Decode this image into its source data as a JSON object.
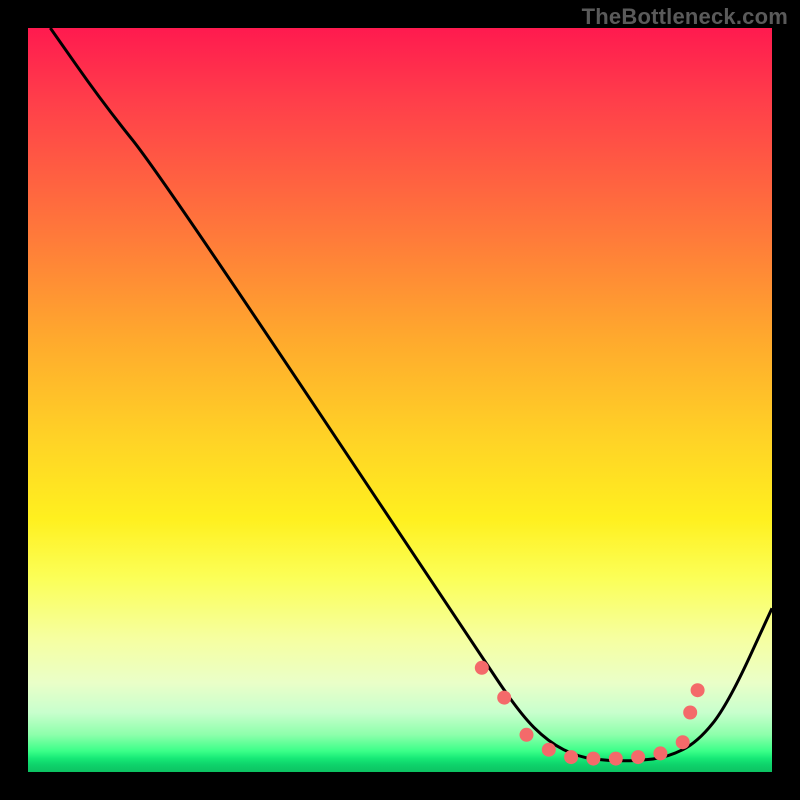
{
  "attribution": "TheBottleneck.com",
  "chart_data": {
    "type": "line",
    "title": "",
    "xlabel": "",
    "ylabel": "",
    "xlim": [
      0,
      100
    ],
    "ylim": [
      0,
      100
    ],
    "series": [
      {
        "name": "curve",
        "x": [
          3,
          10,
          18,
          60,
          66,
          70,
          74,
          78,
          82,
          86,
          90,
          94,
          100
        ],
        "values": [
          100,
          90,
          80,
          17,
          8,
          4,
          2,
          1.5,
          1.5,
          2,
          4,
          9,
          22
        ]
      }
    ],
    "markers": {
      "name": "highlight-dots",
      "x": [
        61,
        64,
        67,
        70,
        73,
        76,
        79,
        82,
        85,
        88,
        89,
        90
      ],
      "values": [
        14,
        10,
        5,
        3,
        2,
        1.8,
        1.8,
        2,
        2.5,
        4,
        8,
        11
      ],
      "color": "#f46a6a",
      "radius_px": 7
    }
  }
}
